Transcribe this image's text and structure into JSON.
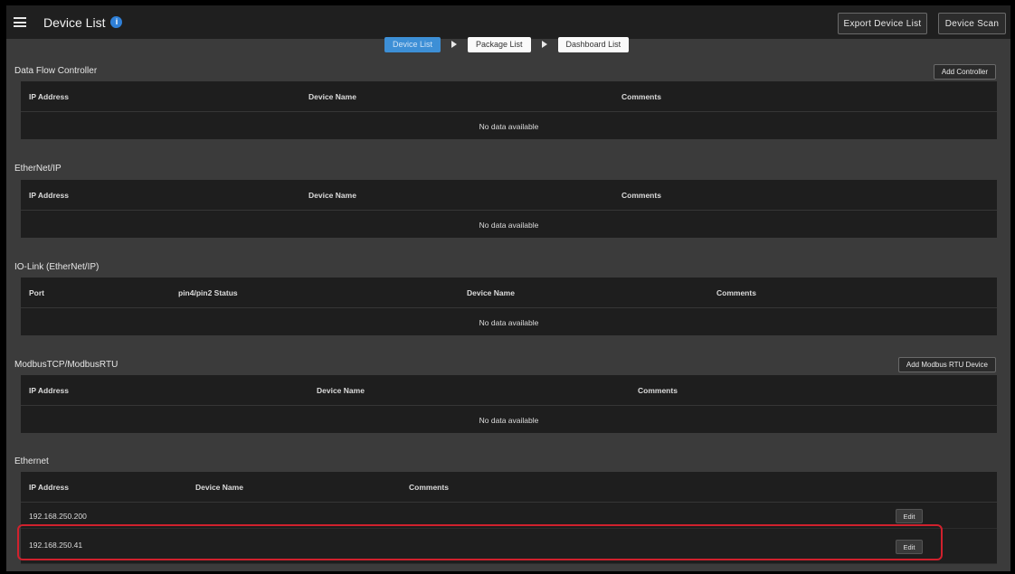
{
  "app": {
    "title": "Device List"
  },
  "toolbar": {
    "export_label": "Export Device List",
    "scan_label": "Device Scan"
  },
  "steps": [
    "Device List",
    "Package List",
    "Dashboard List"
  ],
  "sections": {
    "dfc": {
      "title": "Data Flow Controller",
      "button": "Add Controller",
      "headers": [
        "IP Address",
        "Device Name",
        "Comments"
      ],
      "empty": "No data available"
    },
    "enip": {
      "title": "EtherNet/IP",
      "headers": [
        "IP Address",
        "Device Name",
        "Comments"
      ],
      "empty": "No data available"
    },
    "iolink": {
      "title": "IO-Link  (EtherNet/IP)",
      "headers": [
        "Port",
        "pin4/pin2 Status",
        "Device Name",
        "Comments"
      ],
      "empty": "No data available"
    },
    "modbus": {
      "title": "ModbusTCP/ModbusRTU",
      "button": "Add Modbus RTU Device",
      "headers": [
        "IP Address",
        "Device Name",
        "Comments"
      ],
      "empty": "No data available"
    },
    "ethernet": {
      "title": "Ethernet",
      "headers": [
        "IP Address",
        "Device Name",
        "Comments"
      ],
      "rows": [
        {
          "ip": "192.168.250.200",
          "edit": "Edit"
        },
        {
          "ip": "192.168.250.41",
          "edit": "Edit"
        }
      ]
    }
  },
  "colors": {
    "topbar": "#1f1f1f",
    "background": "#3b3b3b",
    "accent": "#3d8fd6",
    "highlight": "#d0212d"
  }
}
